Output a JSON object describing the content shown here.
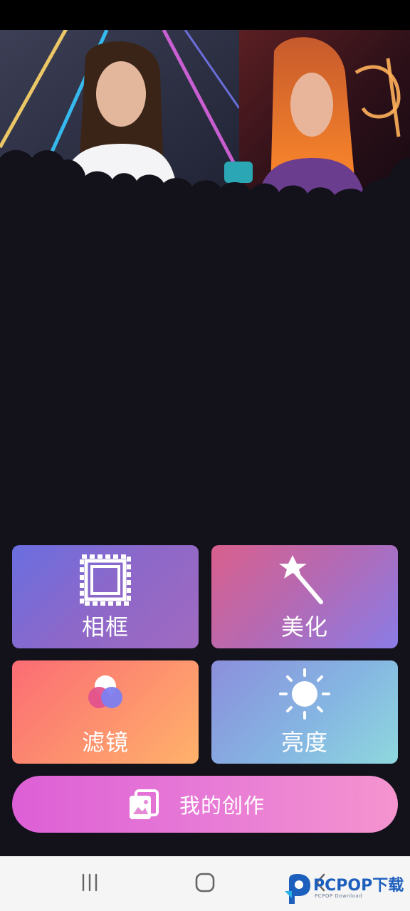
{
  "tiles": {
    "frame": {
      "label": "相框",
      "icon": "stamp-frame-icon"
    },
    "beauty": {
      "label": "美化",
      "icon": "magic-wand-icon"
    },
    "filter": {
      "label": "滤镜",
      "icon": "filter-circles-icon"
    },
    "brightness": {
      "label": "亮度",
      "icon": "sun-icon"
    }
  },
  "creation_button": {
    "label": "我的创作",
    "icon": "gallery-icon"
  },
  "nav_bar": {
    "recents": "recents-icon",
    "home": "home-icon",
    "back": "back-icon"
  },
  "watermark": {
    "brand": "PCPOP下载",
    "sub": "PCPOP Download"
  },
  "colors": {
    "background": "#13121b",
    "accent_pink": "#e77ad6",
    "accent_blue": "#1d5fbd"
  }
}
